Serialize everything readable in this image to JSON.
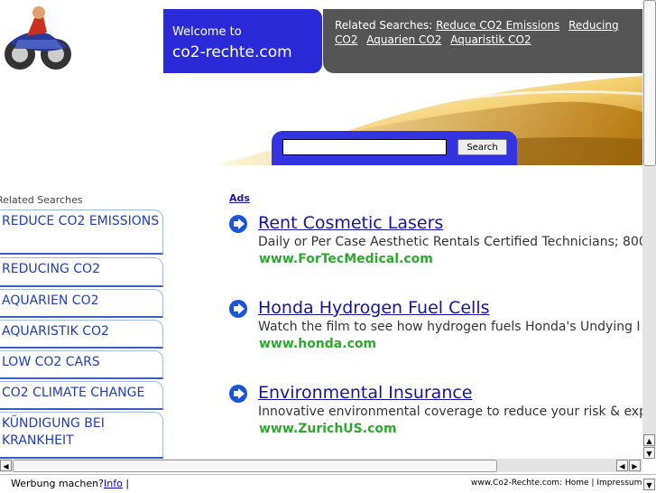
{
  "header": {
    "welcome_small": "Welcome to",
    "domain": "co2-rechte.com",
    "related_label": "Related Searches:",
    "related_links": [
      "Reduce CO2 Emissions",
      "Reducing CO2",
      "Aquarien CO2",
      "Aquaristik CO2"
    ]
  },
  "search": {
    "button_label": "Search",
    "value": ""
  },
  "sidebar": {
    "title": "Related Searches",
    "items": [
      "REDUCE CO2 EMISSIONS",
      "REDUCING CO2",
      "AQUARIEN CO2",
      "AQUARISTIK CO2",
      "LOW CO2 CARS",
      "CO2 CLIMATE CHANGE",
      "KÜNDIGUNG BEI KRANKHEIT"
    ]
  },
  "ads": {
    "label": "Ads",
    "items": [
      {
        "title": "Rent Cosmetic Lasers",
        "desc": "Daily or Per Case Aesthetic Rentals Certified Technicians; 800",
        "url": "www.ForTecMedical.com"
      },
      {
        "title": "Honda Hydrogen Fuel Cells",
        "desc": "Watch the film to see how hydrogen fuels Honda's Undying I",
        "url": "www.honda.com"
      },
      {
        "title": "Environmental Insurance",
        "desc": "Innovative environmental coverage to reduce your risk & exp",
        "url": "www.ZurichUS.com"
      }
    ]
  },
  "footer": {
    "left_text": "Werbung machen?",
    "left_link": "Info",
    "separator": "|",
    "right_site": "www.Co2-Rechte.com:",
    "right_home": "Home",
    "right_impressum": "Impressum"
  },
  "colors": {
    "brand_blue": "#2a2ad8",
    "ad_url_green": "#2fa830",
    "ad_title_blue": "#1414a0"
  }
}
